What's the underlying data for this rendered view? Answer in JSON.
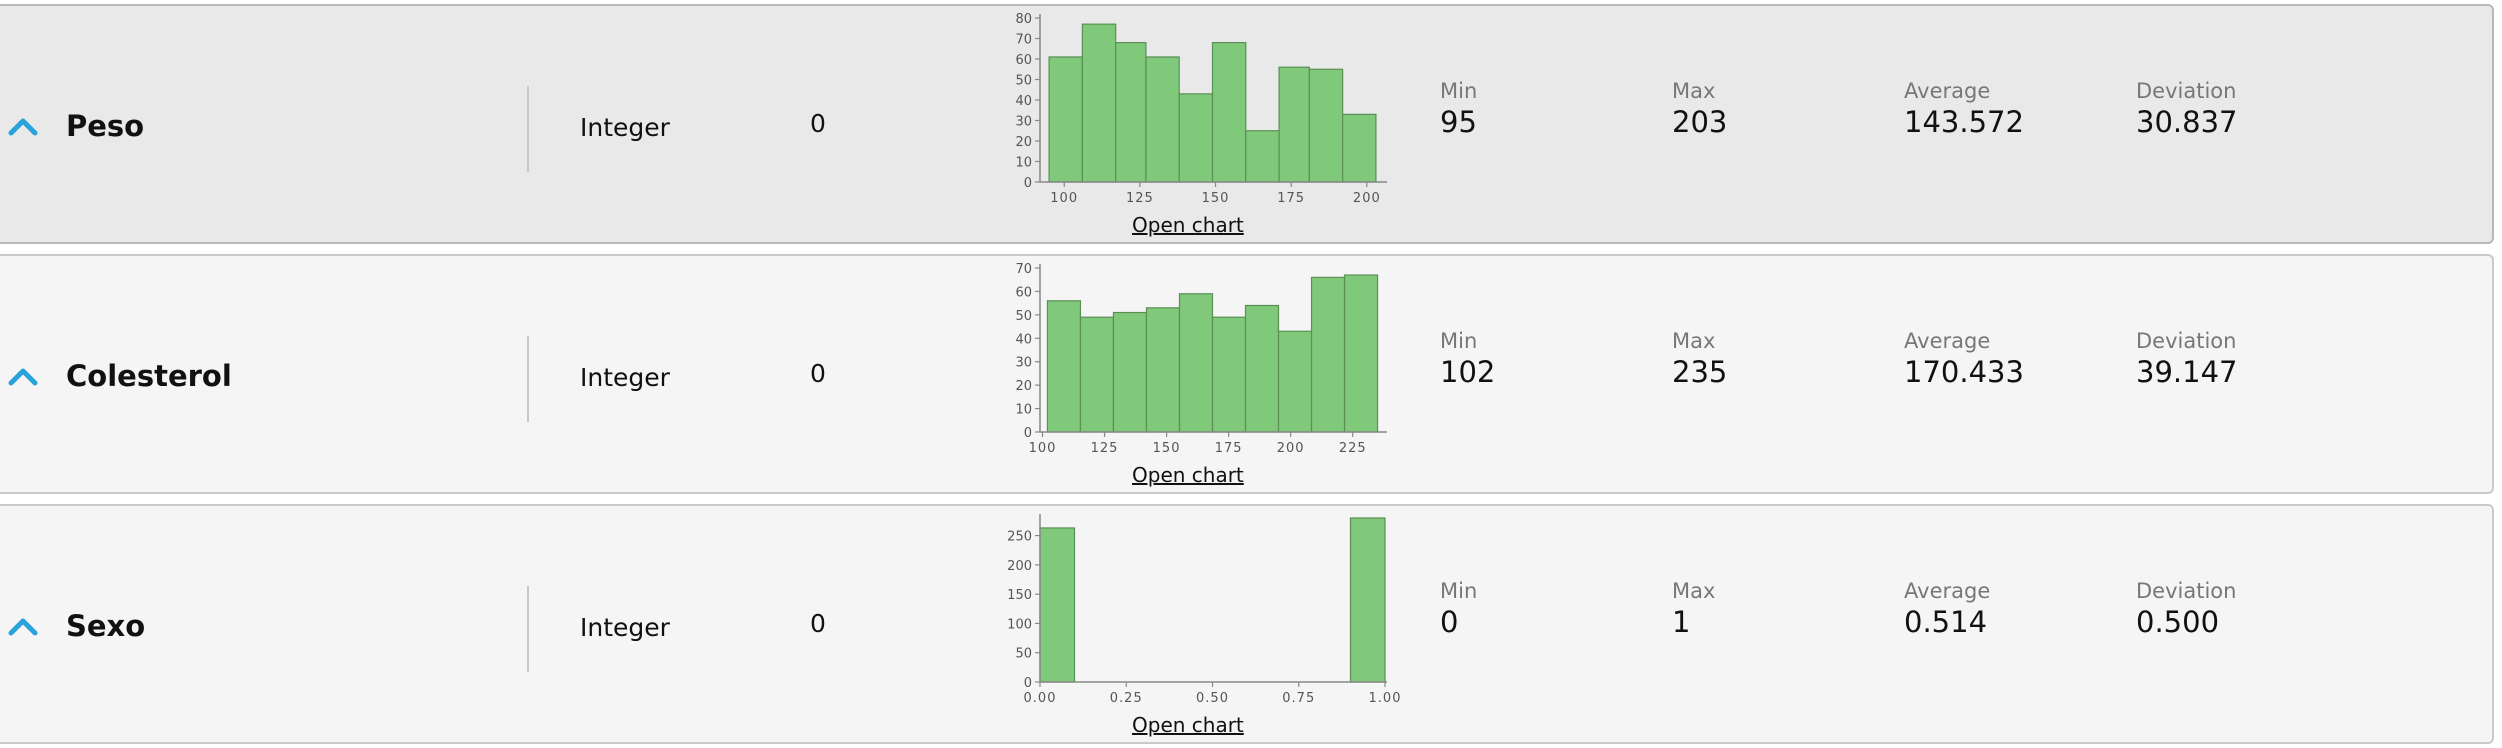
{
  "open_chart_label": "Open chart",
  "stat_labels": {
    "min": "Min",
    "max": "Max",
    "average": "Average",
    "deviation": "Deviation"
  },
  "colors": {
    "bar_fill": "#80c87a",
    "bar_stroke": "#5a8f56",
    "chevron": "#29a3d9",
    "selected_row_bg": "#e9e9e9",
    "row_bg": "#f5f5f5"
  },
  "icons": {
    "expand": "chevron-up-icon"
  },
  "attributes": [
    {
      "name": "Peso",
      "type": "Integer",
      "missing": "0",
      "selected": true,
      "stats": {
        "min": "95",
        "max": "203",
        "average": "143.572",
        "deviation": "30.837"
      }
    },
    {
      "name": "Colesterol",
      "type": "Integer",
      "missing": "0",
      "selected": false,
      "stats": {
        "min": "102",
        "max": "235",
        "average": "170.433",
        "deviation": "39.147"
      }
    },
    {
      "name": "Sexo",
      "type": "Integer",
      "missing": "0",
      "selected": false,
      "stats": {
        "min": "0",
        "max": "1",
        "average": "0.514",
        "deviation": "0.500"
      }
    }
  ],
  "chart_data": [
    {
      "type": "bar",
      "bins": [
        [
          95,
          106
        ],
        [
          106,
          117
        ],
        [
          117,
          127
        ],
        [
          127,
          138
        ],
        [
          138,
          149
        ],
        [
          149,
          160
        ],
        [
          160,
          171
        ],
        [
          171,
          181
        ],
        [
          181,
          192
        ],
        [
          192,
          203
        ]
      ],
      "values": [
        61,
        77,
        68,
        61,
        43,
        68,
        25,
        56,
        55,
        33
      ],
      "xlim": [
        92,
        206
      ],
      "ylim": [
        0,
        80
      ],
      "xticks": [
        100,
        125,
        150,
        175,
        200
      ],
      "xtick_labels": [
        "100",
        "125",
        "150",
        "175",
        "200"
      ],
      "yticks": [
        0,
        10,
        20,
        30,
        40,
        50,
        60,
        70,
        80
      ],
      "ytick_labels": [
        "0",
        "10",
        "20",
        "30",
        "40",
        "50",
        "60",
        "70",
        "80"
      ],
      "grid": false
    },
    {
      "type": "bar",
      "bins": [
        [
          102,
          115.3
        ],
        [
          115.3,
          128.6
        ],
        [
          128.6,
          141.9
        ],
        [
          141.9,
          155.2
        ],
        [
          155.2,
          168.5
        ],
        [
          168.5,
          181.8
        ],
        [
          181.8,
          195.1
        ],
        [
          195.1,
          208.4
        ],
        [
          208.4,
          221.7
        ],
        [
          221.7,
          235
        ]
      ],
      "values": [
        56,
        49,
        51,
        53,
        59,
        49,
        54,
        43,
        66,
        67
      ],
      "xlim": [
        99,
        238
      ],
      "ylim": [
        0,
        70
      ],
      "xticks": [
        100,
        125,
        150,
        175,
        200,
        225
      ],
      "xtick_labels": [
        "100",
        "125",
        "150",
        "175",
        "200",
        "225"
      ],
      "yticks": [
        0,
        10,
        20,
        30,
        40,
        50,
        60,
        70
      ],
      "ytick_labels": [
        "0",
        "10",
        "20",
        "30",
        "40",
        "50",
        "60",
        "70"
      ],
      "grid": false
    },
    {
      "type": "bar",
      "bins": [
        [
          0,
          0.1
        ],
        [
          0.9,
          1.0
        ]
      ],
      "values": [
        263,
        280
      ],
      "xlim": [
        0,
        1.0
      ],
      "ylim": [
        0,
        280
      ],
      "xticks": [
        0,
        0.25,
        0.5,
        0.75,
        1.0
      ],
      "xtick_labels": [
        "0.00",
        "0.25",
        "0.50",
        "0.75",
        "1.00"
      ],
      "yticks": [
        0,
        50,
        100,
        150,
        200,
        250
      ],
      "ytick_labels": [
        "0",
        "50",
        "100",
        "150",
        "200",
        "250"
      ],
      "grid": false
    }
  ]
}
